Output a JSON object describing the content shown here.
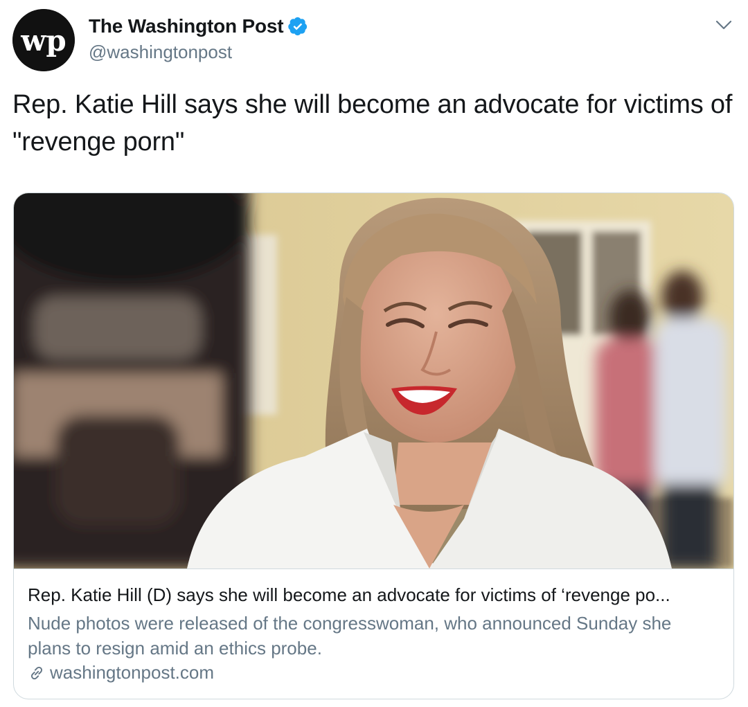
{
  "author": {
    "display_name": "The Washington Post",
    "handle": "@washingtonpost",
    "avatar_text": "wp",
    "verified": true
  },
  "tweet": {
    "text": "Rep. Katie Hill says she will become an advocate for victims of \"revenge porn\""
  },
  "card": {
    "title": "Rep. Katie Hill (D) says she will become an advocate for victims of ‘revenge po...",
    "description": "Nude photos were released of the congresswoman, who announced Sunday she plans to resign amid an ethics probe.",
    "domain": "washingtonpost.com"
  },
  "icons": {
    "verified": "verified-badge-icon",
    "menu": "chevron-down-icon",
    "link": "link-icon"
  },
  "colors": {
    "verified": "#1da1f2",
    "secondary_text": "#657786",
    "card_border": "#cfd9de"
  }
}
